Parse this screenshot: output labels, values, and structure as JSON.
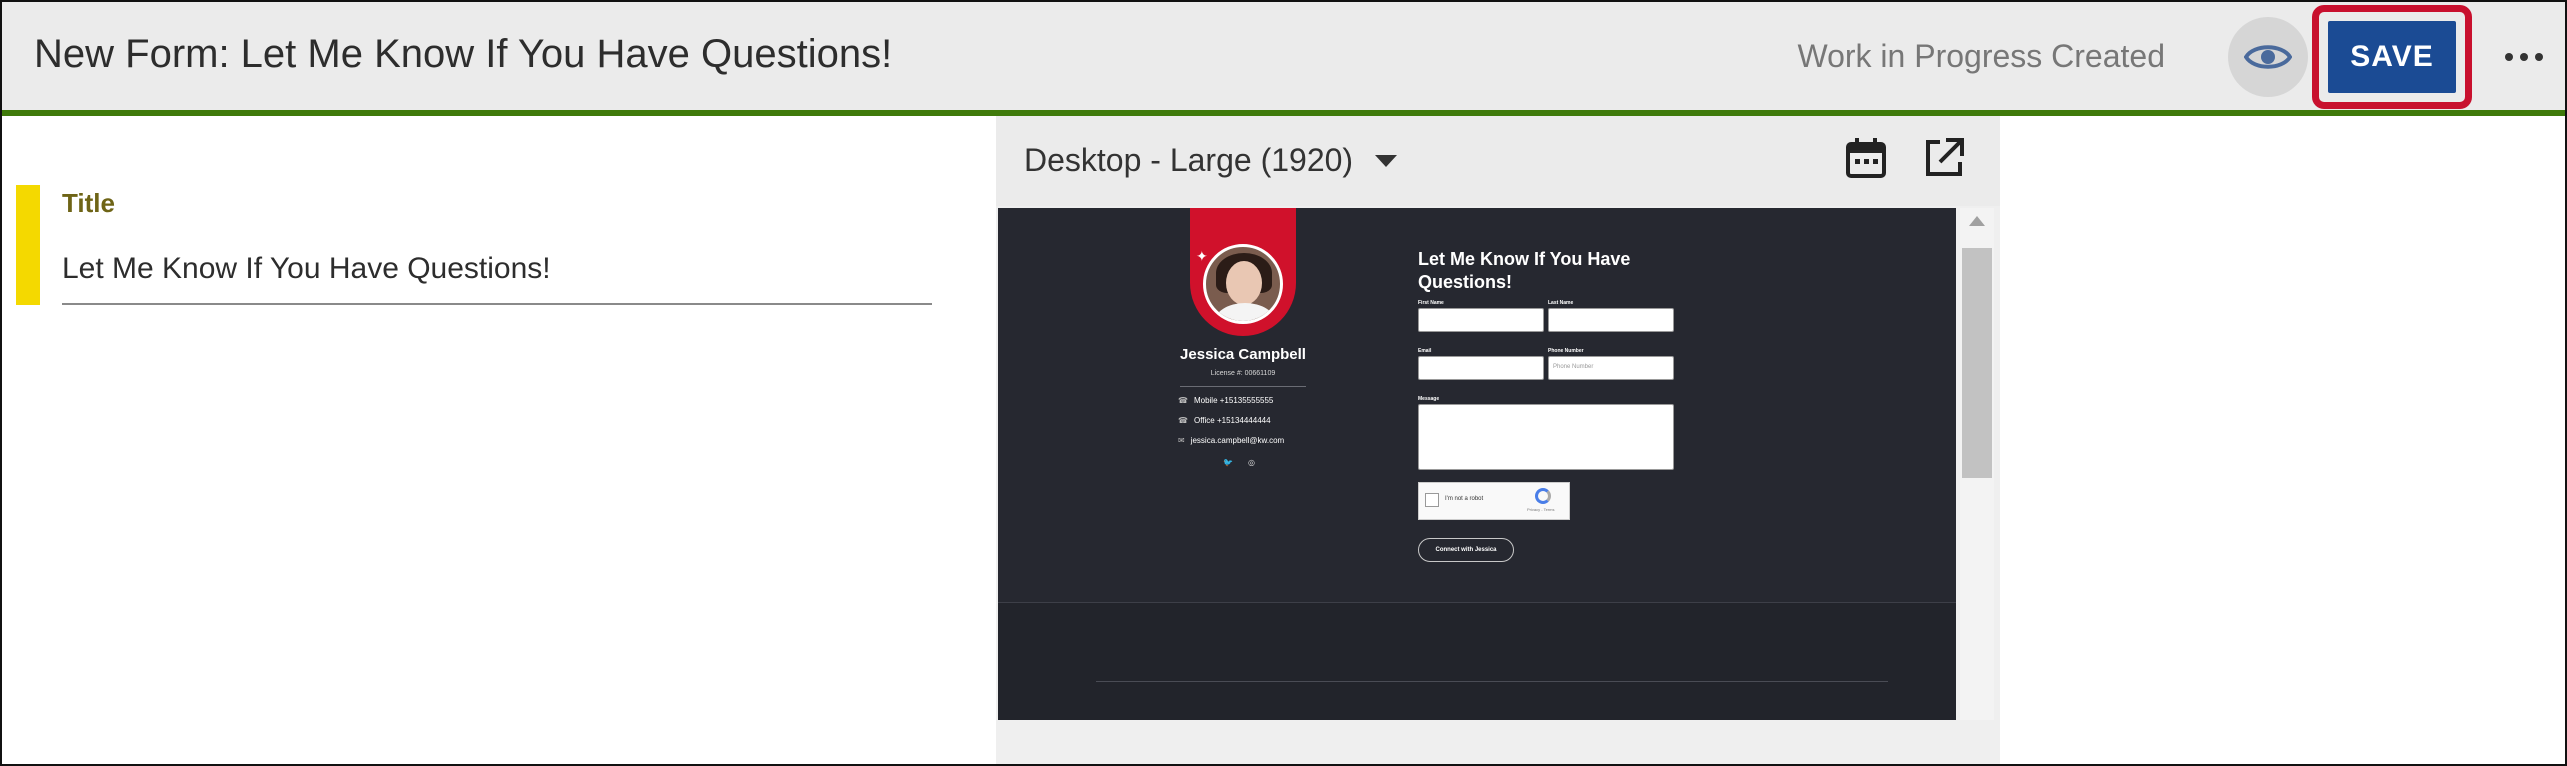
{
  "header": {
    "title": "New Form: Let Me Know If You Have Questions!",
    "status": "Work in Progress Created",
    "save_label": "SAVE",
    "preview_icon": "eye-icon",
    "more_icon": "more-horizontal-icon"
  },
  "field": {
    "label": "Title",
    "value": "Let Me Know If You Have Questions!"
  },
  "preview": {
    "device_selected": "Desktop - Large (1920)",
    "schedule_icon": "calendar-icon",
    "open_icon": "external-link-icon",
    "profile": {
      "name": "Jessica Campbell",
      "license": "License #: 00661109",
      "contacts": [
        {
          "icon": "phone-icon",
          "text": "Mobile +15135555555"
        },
        {
          "icon": "phone-icon",
          "text": "Office +15134444444"
        },
        {
          "icon": "mail-icon",
          "text": "jessica.campbell@kw.com"
        }
      ],
      "social": [
        "twitter-icon",
        "instagram-icon"
      ]
    },
    "form": {
      "title": "Let Me Know If You Have Questions!",
      "first_name_label": "First Name",
      "last_name_label": "Last Name",
      "email_label": "Email",
      "phone_label": "Phone Number",
      "phone_placeholder": "Phone Number",
      "message_label": "Message",
      "captcha_text": "I'm not a robot",
      "captcha_terms": "Privacy - Terms",
      "submit_label": "Connect with Jessica"
    }
  },
  "colors": {
    "header_bg": "#ebebeb",
    "header_underline": "#3f7a0b",
    "save_button": "#1b4b94",
    "save_highlight": "#c8102e",
    "field_accent": "#f4d900",
    "field_label": "#6e6416",
    "preview_dark": "#262830",
    "brand_red": "#d0112b"
  }
}
